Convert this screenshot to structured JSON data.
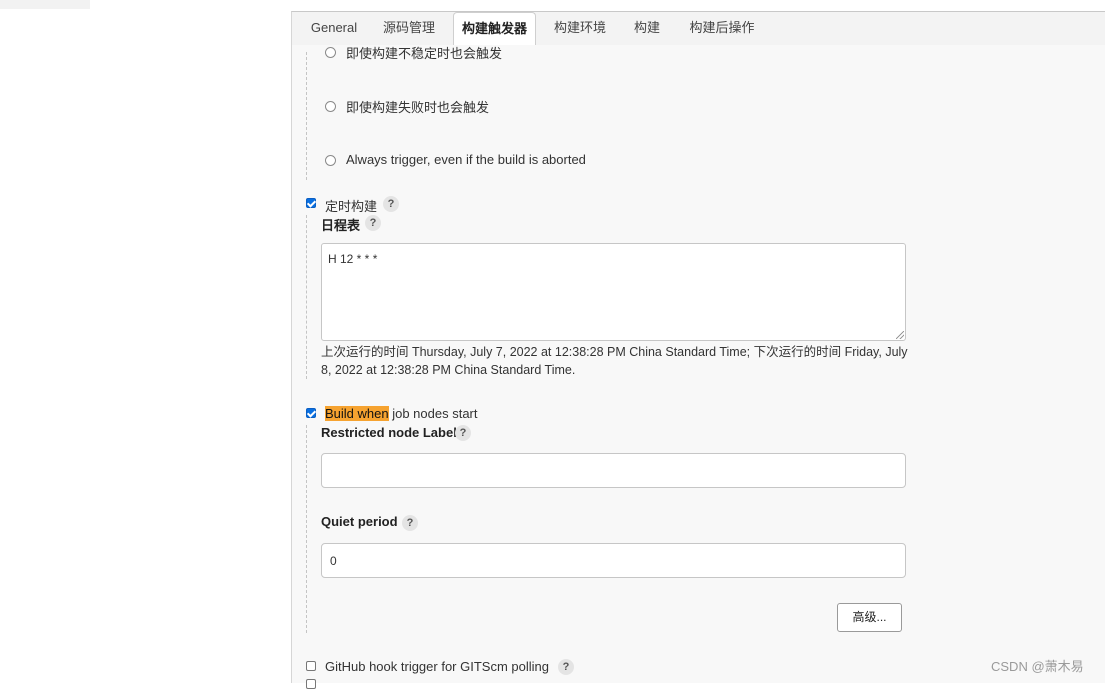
{
  "tabs": [
    "General",
    "源码管理",
    "构建触发器",
    "构建环境",
    "构建",
    "构建后操作"
  ],
  "active_tab": "构建触发器",
  "trigger_options": {
    "unstable": "即使构建不稳定时也会触发",
    "failed": "即使构建失败时也会触发",
    "aborted": "Always trigger, even if the build is aborted"
  },
  "scheduled_build": {
    "label": "定时构建",
    "checked": true,
    "schedule_label": "日程表",
    "schedule_value": "H 12 * * *",
    "info_line1": "上次运行的时间 Thursday, July 7, 2022 at 12:38:28 PM China Standard Time; 下次运行的时间 Friday, July",
    "info_line2": "8, 2022 at 12:38:28 PM China Standard Time."
  },
  "build_when": {
    "highlight": "Build when",
    "rest": " job nodes start",
    "checked": true,
    "restricted_label": "Restricted node Label",
    "restricted_value": "",
    "quiet_label": "Quiet period",
    "quiet_value": "0",
    "advanced_button": "高级..."
  },
  "github_hook": {
    "label": "GitHub hook trigger for GITScm polling",
    "checked": false
  },
  "help_glyph": "?",
  "watermark": "CSDN @萧木易",
  "colors": {
    "highlight": "#f6a330",
    "checkbox": "#0a6fe0",
    "panel_bg": "#f8f8f8"
  }
}
